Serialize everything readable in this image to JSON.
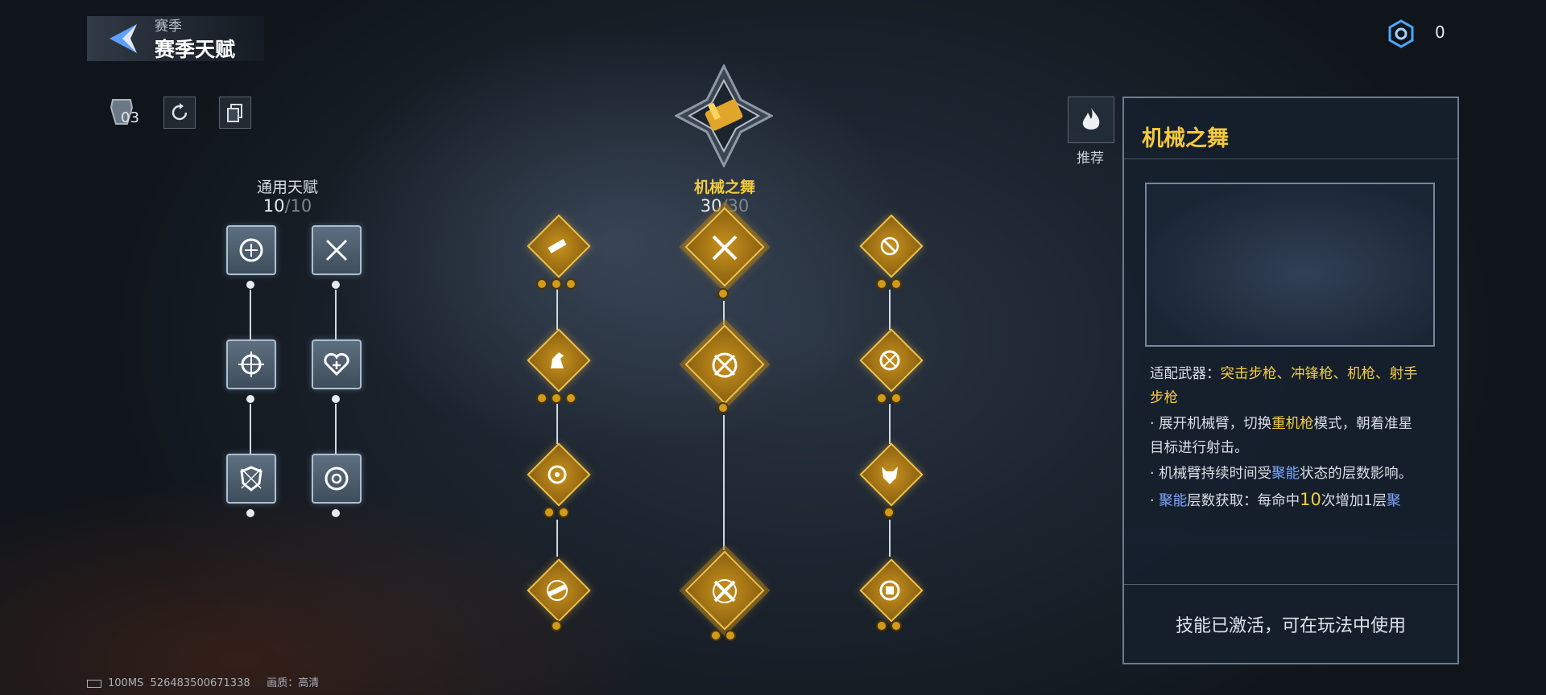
{
  "header": {
    "subtitle": "赛季",
    "title": "赛季天赋"
  },
  "currency": {
    "value": "0"
  },
  "toolbar": {
    "count": "03"
  },
  "general": {
    "title": "通用天赋",
    "progress_current": "10",
    "progress_total": "/10"
  },
  "spec": {
    "title": "机械之舞",
    "progress_current": "30",
    "progress_total": "/30"
  },
  "recommend": {
    "label": "推荐"
  },
  "detail": {
    "title": "机械之舞",
    "weapons_prefix": "适配武器：",
    "weapons": "突击步枪、冲锋枪、机枪、射手步枪",
    "line1_a": "· 展开机械臂，切换",
    "line1_hl": "重机枪",
    "line1_b": "模式，朝着准星目标进行射击。",
    "line2_a": "· 机械臂持续时间受",
    "line2_hl": "聚能",
    "line2_b": "状态的层数影响。",
    "line3_a": "· ",
    "line3_hl": "聚能",
    "line3_b": "层数获取：每命中",
    "line3_num": "10",
    "line3_c": "次增加1层",
    "line3_hl2": "聚",
    "status": "技能已激活，可在玩法中使用"
  },
  "footer": {
    "battery": "100MS",
    "uid": "526483500671338",
    "quality": "画质：高清"
  },
  "colors": {
    "gold": "#f3c93e",
    "blue_hl": "#7ba7ff",
    "panel_bg": "#16202e"
  }
}
